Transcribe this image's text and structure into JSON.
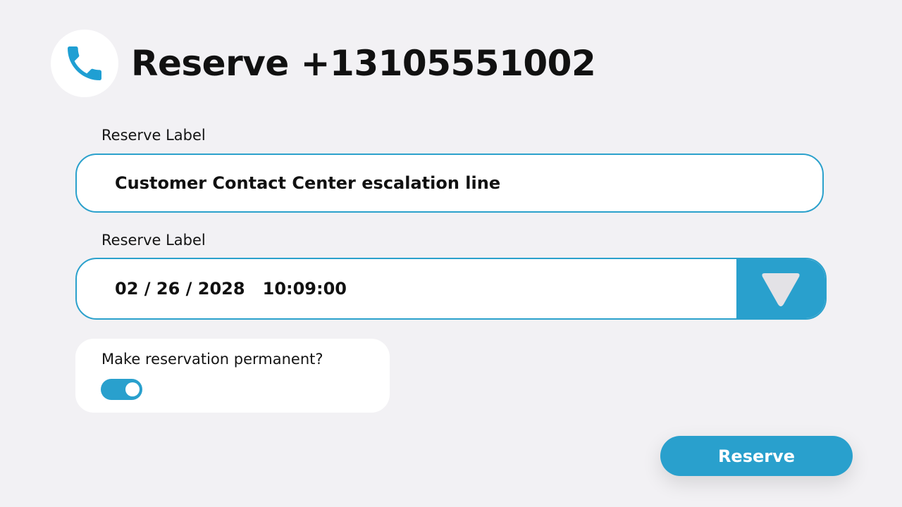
{
  "header": {
    "title": "Reserve +13105551002",
    "icon": "phone-icon"
  },
  "form": {
    "label_field": {
      "label": "Reserve Label",
      "value": "Customer Contact Center escalation line"
    },
    "datetime_field": {
      "label": "Reserve Label",
      "value": "02 / 26 / 2028   10:09:00",
      "toggle_icon": "triangle-down-icon"
    },
    "permanent": {
      "label": "Make reservation permanent?",
      "enabled": true
    }
  },
  "actions": {
    "reserve_label": "Reserve"
  },
  "colors": {
    "accent": "#29a0cd",
    "background": "#f2f1f4",
    "card": "#ffffff"
  }
}
